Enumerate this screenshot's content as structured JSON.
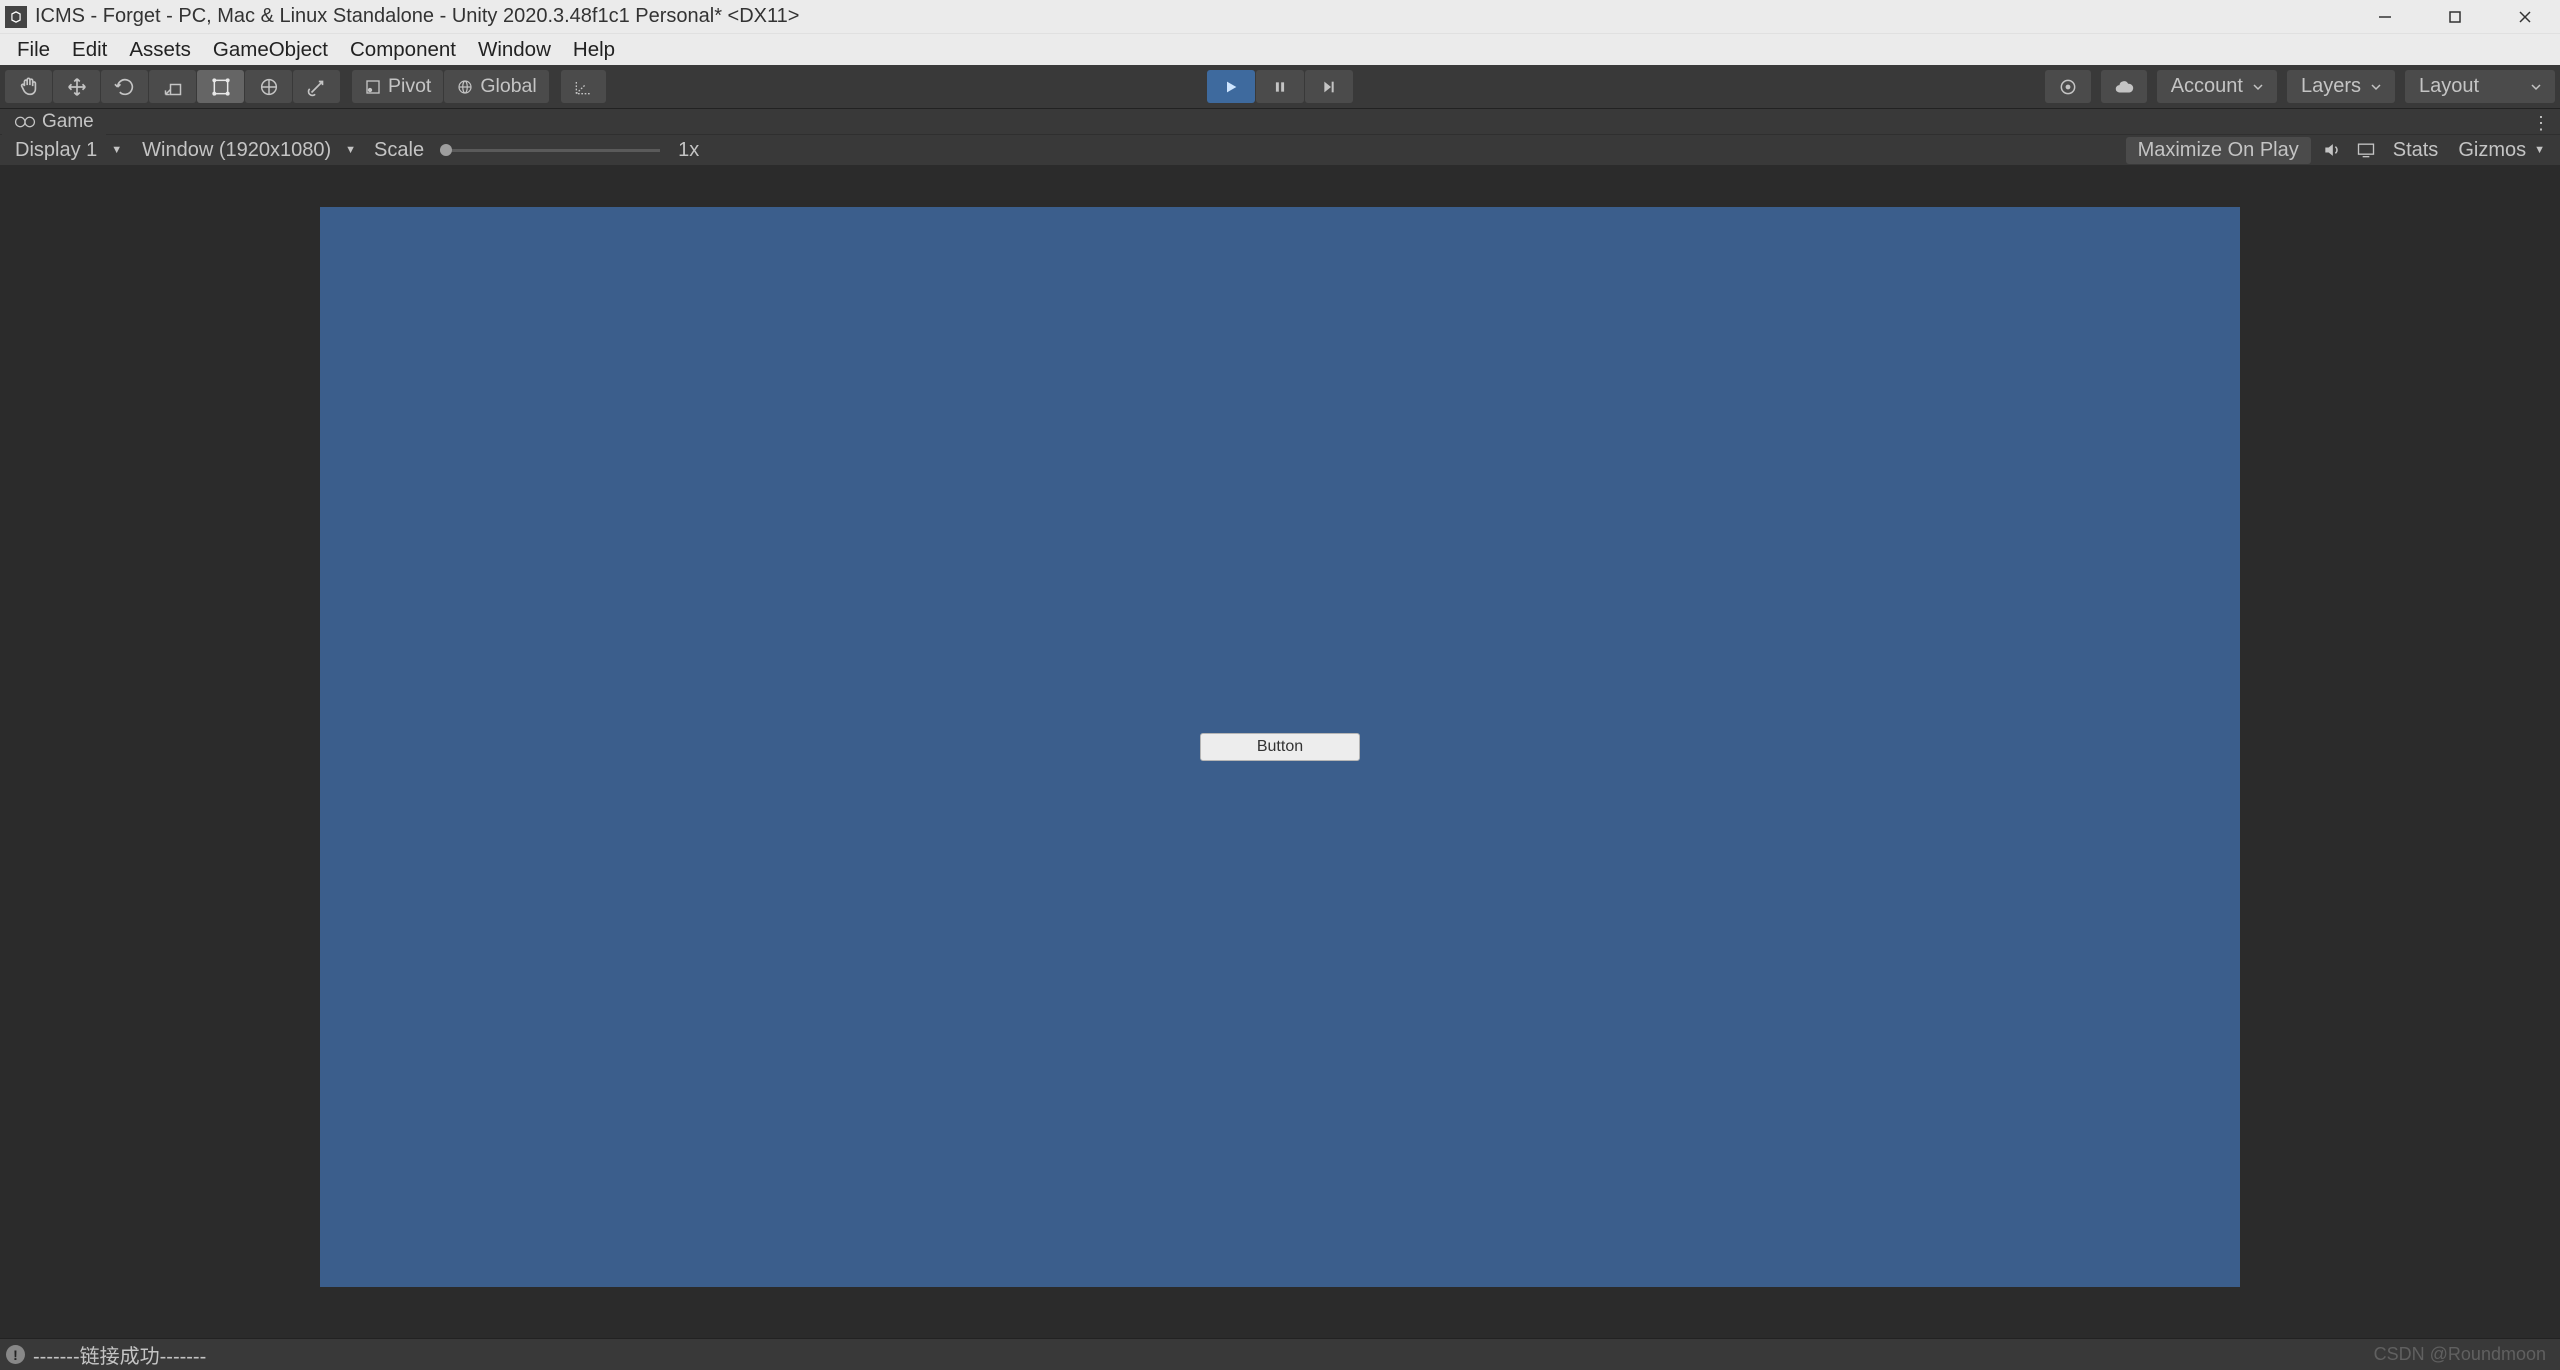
{
  "window": {
    "title": "ICMS - Forget - PC, Mac & Linux Standalone - Unity 2020.3.48f1c1 Personal* <DX11>"
  },
  "menu": {
    "items": [
      "File",
      "Edit",
      "Assets",
      "GameObject",
      "Component",
      "Window",
      "Help"
    ]
  },
  "toolbar": {
    "pivot_label": "Pivot",
    "global_label": "Global",
    "account_label": "Account",
    "layers_label": "Layers",
    "layout_label": "Layout"
  },
  "tabs": {
    "game": "Game"
  },
  "game_ctrl": {
    "display": "Display 1",
    "resolution": "Window (1920x1080)",
    "scale_label": "Scale",
    "scale_value": "1x",
    "maximize": "Maximize On Play",
    "stats": "Stats",
    "gizmos": "Gizmos"
  },
  "canvas": {
    "button_label": "Button"
  },
  "status": {
    "message": "-------链接成功-------",
    "watermark": "CSDN @Roundmoon"
  }
}
